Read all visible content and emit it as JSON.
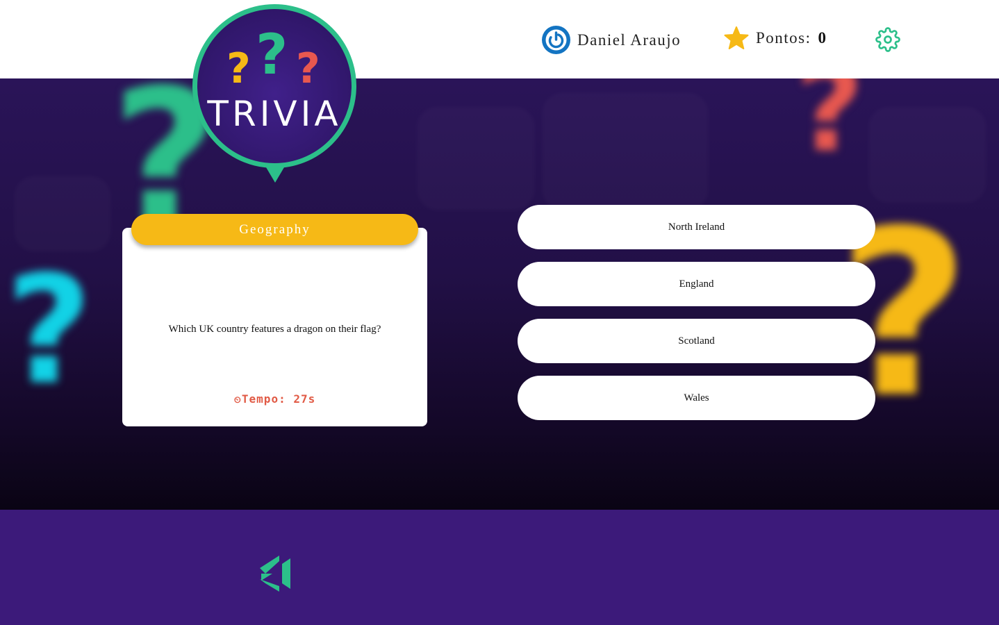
{
  "header": {
    "user_name": "Daniel Araujo",
    "points_label": "Pontos:",
    "points_value": "0",
    "power_icon": "power-icon",
    "star_icon": "star-icon",
    "settings_icon": "gear-icon"
  },
  "logo": {
    "text": "TRIVIA",
    "marks": [
      "?",
      "?",
      "?"
    ]
  },
  "question": {
    "category": "Geography",
    "text": "Which UK country features a dragon on their flag?",
    "timer_icon": "⏲",
    "timer_label": "Tempo: 27s"
  },
  "answers": [
    "North Ireland",
    "England",
    "Scotland",
    "Wales"
  ],
  "colors": {
    "brand_green": "#2cbf8a",
    "accent_yellow": "#f6b916",
    "timer_red": "#e15a45",
    "power_blue": "#1374c2",
    "footer_purple": "#3c1a7a"
  }
}
